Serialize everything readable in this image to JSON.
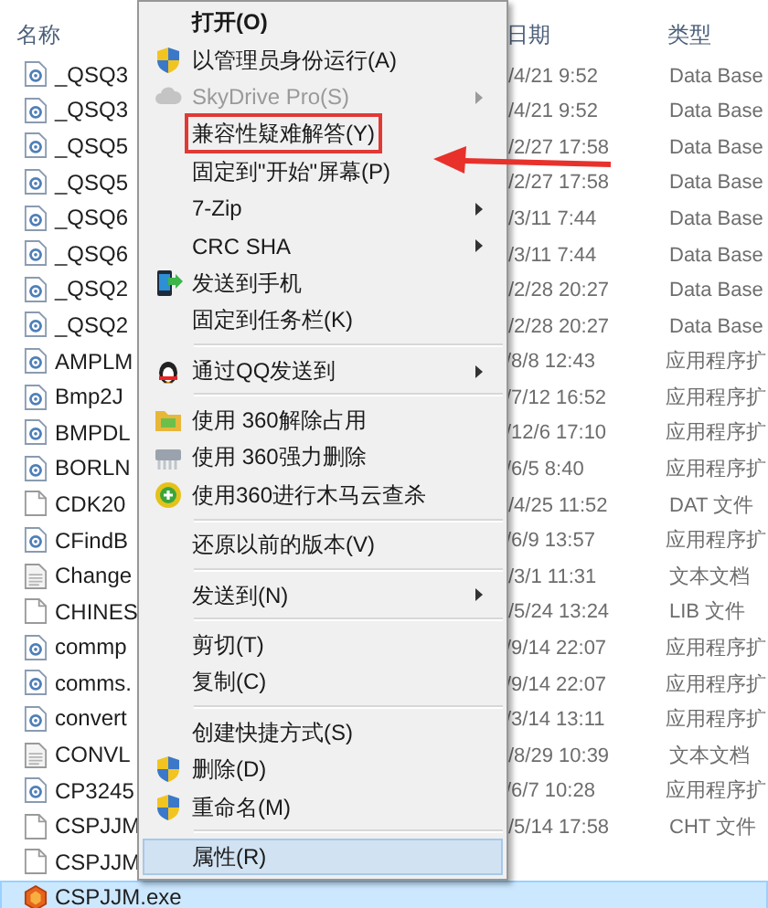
{
  "columns": [
    "名称",
    "日期",
    "类型"
  ],
  "files": [
    {
      "name": "_QSQ3",
      "date": "/4/21 9:52",
      "type": "Data Base",
      "kind": "dll",
      "selected": false
    },
    {
      "name": "_QSQ3",
      "date": "/4/21 9:52",
      "type": "Data Base",
      "kind": "dll",
      "selected": false
    },
    {
      "name": "_QSQ5",
      "date": "/2/27 17:58",
      "type": "Data Base",
      "kind": "dll",
      "selected": false
    },
    {
      "name": "_QSQ5",
      "date": "/2/27 17:58",
      "type": "Data Base",
      "kind": "dll",
      "selected": false
    },
    {
      "name": "_QSQ6",
      "date": "/3/11 7:44",
      "type": "Data Base",
      "kind": "dll",
      "selected": false
    },
    {
      "name": "_QSQ6",
      "date": "/3/11 7:44",
      "type": "Data Base",
      "kind": "dll",
      "selected": false
    },
    {
      "name": "_QSQ2",
      "date": "/2/28 20:27",
      "type": "Data Base",
      "kind": "dll",
      "selected": false
    },
    {
      "name": "_QSQ2",
      "date": "/2/28 20:27",
      "type": "Data Base",
      "kind": "dll",
      "selected": false
    },
    {
      "name": "AMPLM",
      "date": "/8/8 12:43",
      "type": "应用程序扩",
      "kind": "dll",
      "selected": false
    },
    {
      "name": "Bmp2J",
      "date": "/7/12 16:52",
      "type": "应用程序扩",
      "kind": "dll",
      "selected": false
    },
    {
      "name": "BMPDL",
      "date": "/12/6 17:10",
      "type": "应用程序扩",
      "kind": "dll",
      "selected": false
    },
    {
      "name": "BORLN",
      "date": "/6/5 8:40",
      "type": "应用程序扩",
      "kind": "dll",
      "selected": false
    },
    {
      "name": "CDK20",
      "date": "/4/25 11:52",
      "type": "DAT 文件",
      "kind": "blank",
      "selected": false
    },
    {
      "name": "CFindB",
      "date": "/6/9 13:57",
      "type": "应用程序扩",
      "kind": "dll",
      "selected": false
    },
    {
      "name": "Change",
      "date": "/3/1 11:31",
      "type": "文本文档",
      "kind": "text",
      "selected": false
    },
    {
      "name": "CHINES",
      "date": "/5/24 13:24",
      "type": "LIB 文件",
      "kind": "blank",
      "selected": false
    },
    {
      "name": "commp",
      "date": "/9/14 22:07",
      "type": "应用程序扩",
      "kind": "dll",
      "selected": false
    },
    {
      "name": "comms.",
      "date": "/9/14 22:07",
      "type": "应用程序扩",
      "kind": "dll",
      "selected": false
    },
    {
      "name": "convert",
      "date": "/3/14 13:11",
      "type": "应用程序扩",
      "kind": "dll",
      "selected": false
    },
    {
      "name": "CONVL",
      "date": "/8/29 10:39",
      "type": "文本文档",
      "kind": "text",
      "selected": false
    },
    {
      "name": "CP3245",
      "date": "/6/7 10:28",
      "type": "应用程序扩",
      "kind": "dll",
      "selected": false
    },
    {
      "name": "CSPJJM",
      "date": "/5/14 17:58",
      "type": "CHT 文件",
      "kind": "blank",
      "selected": false
    },
    {
      "name": "CSPJJM",
      "kind": "blank",
      "selected": false
    },
    {
      "name": "CSPJJM.exe",
      "kind": "exe",
      "selected": true
    }
  ],
  "context_menu": [
    {
      "kind": "plain",
      "label": "打开(O)",
      "default": true
    },
    {
      "kind": "shield",
      "label": "以管理员身份运行(A)"
    },
    {
      "kind": "cloud",
      "label": "SkyDrive Pro(S)",
      "disabled": true,
      "submenu": true
    },
    {
      "kind": "plain",
      "label": "兼容性疑难解答(Y)",
      "boxed": true
    },
    {
      "kind": "plain",
      "label": "固定到\"开始\"屏幕(P)"
    },
    {
      "kind": "plain",
      "label": "7-Zip",
      "submenu": true
    },
    {
      "kind": "plain",
      "label": "CRC SHA",
      "submenu": true
    },
    {
      "kind": "phone",
      "label": "发送到手机"
    },
    {
      "kind": "plain",
      "label": "固定到任务栏(K)"
    },
    {
      "kind": "penguin",
      "label": "通过QQ发送到",
      "submenu": true,
      "separator_before": true
    },
    {
      "kind": "folder",
      "label": "使用 360解除占用",
      "separator_before": true
    },
    {
      "kind": "shredder",
      "label": "使用 360强力删除"
    },
    {
      "kind": "plus",
      "label": "使用360进行木马云查杀"
    },
    {
      "kind": "plain",
      "label": "还原以前的版本(V)",
      "separator_before": true
    },
    {
      "kind": "plain",
      "label": "发送到(N)",
      "submenu": true,
      "separator_before": true
    },
    {
      "kind": "plain",
      "label": "剪切(T)",
      "separator_before": true
    },
    {
      "kind": "plain",
      "label": "复制(C)"
    },
    {
      "kind": "plain",
      "label": "创建快捷方式(S)",
      "separator_before": true
    },
    {
      "kind": "shield",
      "label": "删除(D)"
    },
    {
      "kind": "shield",
      "label": "重命名(M)"
    },
    {
      "kind": "plain",
      "label": "属性(R)",
      "selected": true,
      "separator_before": true
    }
  ]
}
